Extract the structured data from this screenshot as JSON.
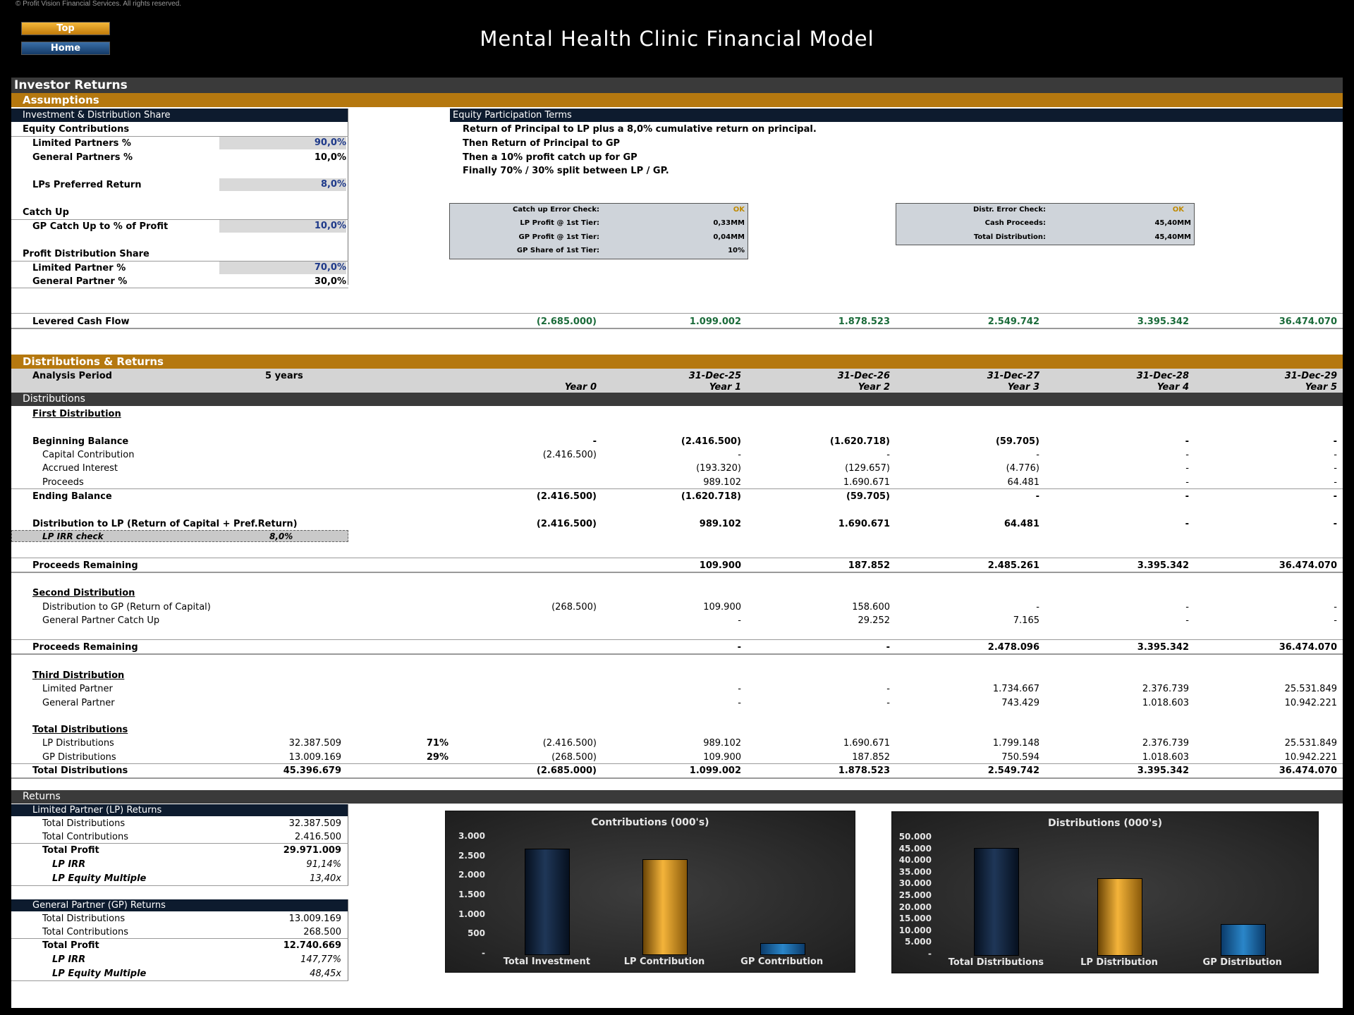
{
  "copyright": "© Profit Vision Financial Services. All rights reserved.",
  "nav": {
    "top": "Top",
    "home": "Home"
  },
  "title": "Mental Health Clinic Financial Model",
  "section_title": "Investor Returns",
  "assumptions": {
    "header": "Assumptions",
    "inv_share_header": "Investment & Distribution Share",
    "equity_contrib": "Equity Contributions",
    "lp_pct_label": "Limited Partners %",
    "lp_pct": "90,0%",
    "gp_pct_label": "General Partners %",
    "gp_pct": "10,0%",
    "pref_label": "LPs Preferred Return",
    "pref": "8,0%",
    "catchup": "Catch Up",
    "catchup_label": "GP Catch Up to % of Profit",
    "catchup_val": "10,0%",
    "profit_share": "Profit Distribution Share",
    "lp_share_label": "Limited Partner %",
    "lp_share": "70,0%",
    "gp_share_label": "General Partner %",
    "gp_share": "30,0%"
  },
  "terms": {
    "header": "Equity Participation Terms",
    "line1": "Return of Principal to LP plus a 8,0% cumulative return on principal.",
    "line2": "Then Return of Principal to GP",
    "line3": "Then a 10% profit catch up for GP",
    "line4": "Finally 70% / 30% split between LP / GP."
  },
  "check1": {
    "l1": "Catch up Error Check:",
    "v1": "OK",
    "l2": "LP Profit @ 1st Tier:",
    "v2": "0,33MM",
    "l3": "GP Profit @ 1st Tier:",
    "v3": "0,04MM",
    "l4": "GP Share of 1st Tier:",
    "v4": "10%"
  },
  "check2": {
    "l1": "Distr. Error Check:",
    "v1": "OK",
    "l2": "Cash Proceeds:",
    "v2": "45,40MM",
    "l3": "Total Distribution:",
    "v3": "45,40MM"
  },
  "levered": {
    "label": "Levered Cash Flow",
    "vals": [
      "(2.685.000)",
      "1.099.002",
      "1.878.523",
      "2.549.742",
      "3.395.342",
      "36.474.070"
    ]
  },
  "dist_header": "Distributions & Returns",
  "period": {
    "label": "Analysis Period",
    "value": "5 years",
    "dates": [
      "31-Dec-25",
      "31-Dec-26",
      "31-Dec-27",
      "31-Dec-28",
      "31-Dec-29"
    ],
    "years": [
      "Year 0",
      "Year 1",
      "Year 2",
      "Year 3",
      "Year 4",
      "Year 5"
    ]
  },
  "distributions_label": "Distributions",
  "first": {
    "title": "First Distribution",
    "beg": {
      "label": "Beginning Balance",
      "vals": [
        "-",
        "(2.416.500)",
        "(1.620.718)",
        "(59.705)",
        "-",
        "-"
      ]
    },
    "cap": {
      "label": "Capital Contribution",
      "vals": [
        "(2.416.500)",
        "-",
        "-",
        "-",
        "-",
        "-"
      ]
    },
    "acc": {
      "label": "Accrued Interest",
      "vals": [
        "",
        "(193.320)",
        "(129.657)",
        "(4.776)",
        "-",
        "-"
      ]
    },
    "pro": {
      "label": "Proceeds",
      "vals": [
        "",
        "989.102",
        "1.690.671",
        "64.481",
        "-",
        "-"
      ]
    },
    "end": {
      "label": "Ending Balance",
      "vals": [
        "(2.416.500)",
        "(1.620.718)",
        "(59.705)",
        "-",
        "-",
        "-"
      ]
    },
    "dist": {
      "label": "Distribution to LP (Return of Capital + Pref.Return)",
      "vals": [
        "(2.416.500)",
        "989.102",
        "1.690.671",
        "64.481",
        "-",
        "-"
      ]
    },
    "irr_label": "LP IRR check",
    "irr": "8,0%",
    "rem": {
      "label": "Proceeds Remaining",
      "vals": [
        "",
        "109.900",
        "187.852",
        "2.485.261",
        "3.395.342",
        "36.474.070"
      ]
    }
  },
  "second": {
    "title": "Second Distribution",
    "gp": {
      "label": "Distribution to GP (Return of Capital)",
      "vals": [
        "(268.500)",
        "109.900",
        "158.600",
        "-",
        "-",
        "-"
      ]
    },
    "catch": {
      "label": "General Partner Catch Up",
      "vals": [
        "",
        "-",
        "29.252",
        "7.165",
        "-",
        "-"
      ]
    },
    "rem": {
      "label": "Proceeds Remaining",
      "vals": [
        "",
        "-",
        "-",
        "2.478.096",
        "3.395.342",
        "36.474.070"
      ]
    }
  },
  "third": {
    "title": "Third Distribution",
    "lp": {
      "label": "Limited Partner",
      "vals": [
        "",
        "-",
        "-",
        "1.734.667",
        "2.376.739",
        "25.531.849"
      ]
    },
    "gp": {
      "label": "General Partner",
      "vals": [
        "",
        "-",
        "-",
        "743.429",
        "1.018.603",
        "10.942.221"
      ]
    }
  },
  "total": {
    "title": "Total Distributions",
    "lp": {
      "label": "LP Distributions",
      "sum": "32.387.509",
      "pct": "71%",
      "vals": [
        "(2.416.500)",
        "989.102",
        "1.690.671",
        "1.799.148",
        "2.376.739",
        "25.531.849"
      ]
    },
    "gp": {
      "label": "GP Distributions",
      "sum": "13.009.169",
      "pct": "29%",
      "vals": [
        "(268.500)",
        "109.900",
        "187.852",
        "750.594",
        "1.018.603",
        "10.942.221"
      ]
    },
    "tot": {
      "label": "Total Distributions",
      "sum": "45.396.679",
      "vals": [
        "(2.685.000)",
        "1.099.002",
        "1.878.523",
        "2.549.742",
        "3.395.342",
        "36.474.070"
      ]
    }
  },
  "returns": {
    "header": "Returns",
    "lp": {
      "header": "Limited Partner (LP) Returns",
      "td_l": "Total Distributions",
      "td": "32.387.509",
      "tc_l": "Total Contributions",
      "tc": "2.416.500",
      "tp_l": "Total Profit",
      "tp": "29.971.009",
      "irr_l": "LP IRR",
      "irr": "91,14%",
      "em_l": "LP Equity Multiple",
      "em": "13,40x"
    },
    "gp": {
      "header": "General Partner (GP) Returns",
      "td_l": "Total Distributions",
      "td": "13.009.169",
      "tc_l": "Total Contributions",
      "tc": "268.500",
      "tp_l": "Total Profit",
      "tp": "12.740.669",
      "irr_l": "LP IRR",
      "irr": "147,77%",
      "em_l": "LP Equity Multiple",
      "em": "48,45x"
    }
  },
  "chart_data": [
    {
      "type": "bar",
      "title": "Contributions (000's)",
      "categories": [
        "Total Investment",
        "LP Contribution",
        "GP Contribution"
      ],
      "values": [
        2685,
        2416.5,
        268.5
      ],
      "ylim": [
        0,
        3000
      ],
      "yticks": [
        "3.000",
        "2.500",
        "2.000",
        "1.500",
        "1.000",
        "500",
        "-"
      ],
      "colors": [
        "#0d1b33",
        "#e39e1f",
        "#1f74b5"
      ]
    },
    {
      "type": "bar",
      "title": "Distributions (000's)",
      "categories": [
        "Total Distributions",
        "LP Distribution",
        "GP Distribution"
      ],
      "values": [
        45397,
        32388,
        13009
      ],
      "ylim": [
        0,
        50000
      ],
      "yticks": [
        "50.000",
        "45.000",
        "40.000",
        "35.000",
        "30.000",
        "25.000",
        "20.000",
        "15.000",
        "10.000",
        "5.000",
        "-"
      ],
      "colors": [
        "#0d1b33",
        "#e39e1f",
        "#1f74b5"
      ]
    }
  ]
}
